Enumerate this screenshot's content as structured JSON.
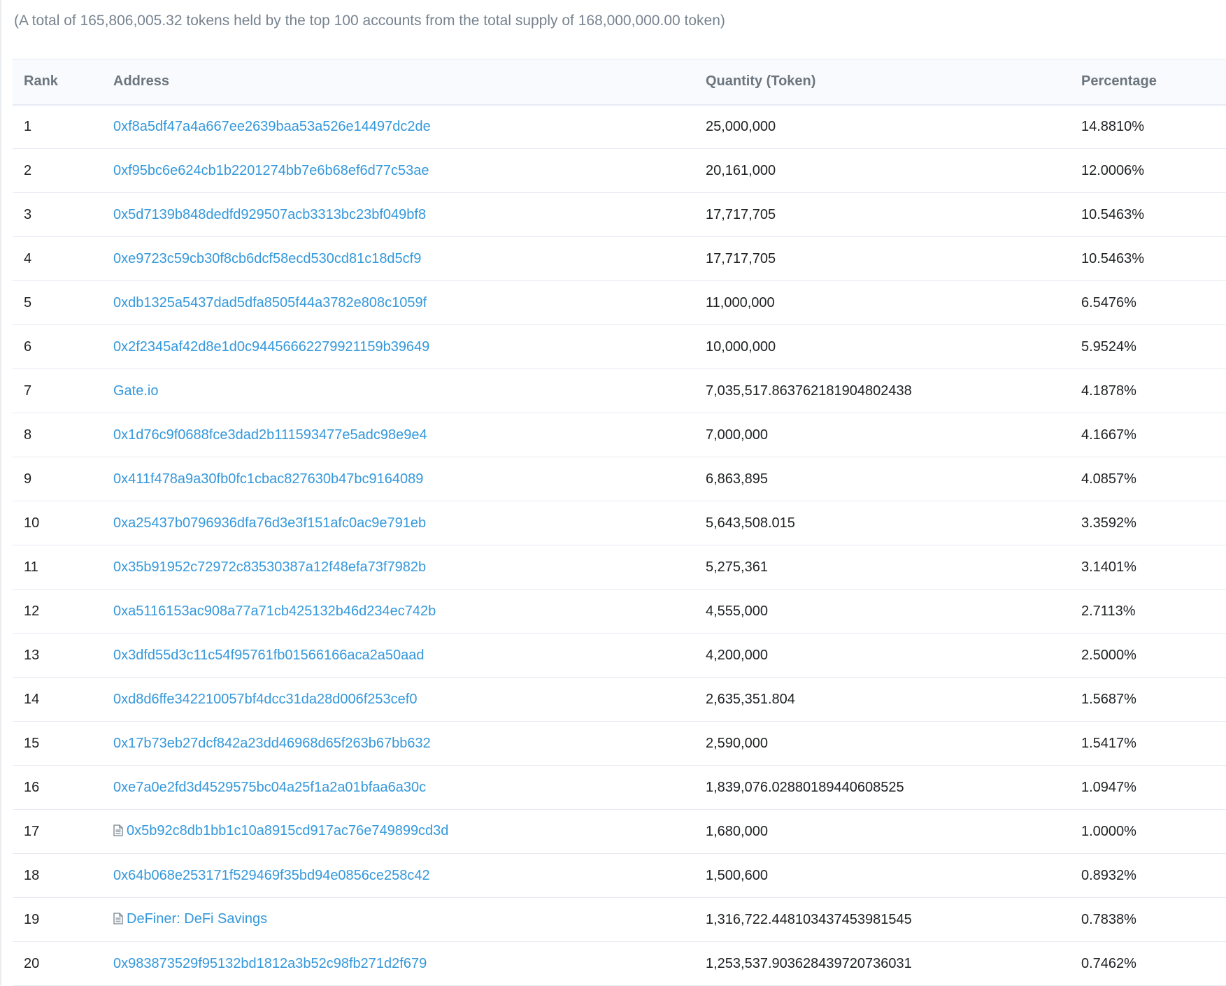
{
  "summary": "(A total of 165,806,005.32 tokens held by the top 100 accounts from the total supply of 168,000,000.00 token)",
  "headers": {
    "rank": "Rank",
    "address": "Address",
    "quantity": "Quantity (Token)",
    "percentage": "Percentage"
  },
  "colors": {
    "link": "#3498db",
    "header_text": "#6c757e",
    "summary_text": "#77838f"
  },
  "rows": [
    {
      "rank": "1",
      "address": "0xf8a5df47a4a667ee2639baa53a526e14497dc2de",
      "quantity": "25,000,000",
      "percentage": "14.8810%",
      "icon": ""
    },
    {
      "rank": "2",
      "address": "0xf95bc6e624cb1b2201274bb7e6b68ef6d77c53ae",
      "quantity": "20,161,000",
      "percentage": "12.0006%",
      "icon": ""
    },
    {
      "rank": "3",
      "address": "0x5d7139b848dedfd929507acb3313bc23bf049bf8",
      "quantity": "17,717,705",
      "percentage": "10.5463%",
      "icon": ""
    },
    {
      "rank": "4",
      "address": "0xe9723c59cb30f8cb6dcf58ecd530cd81c18d5cf9",
      "quantity": "17,717,705",
      "percentage": "10.5463%",
      "icon": ""
    },
    {
      "rank": "5",
      "address": "0xdb1325a5437dad5dfa8505f44a3782e808c1059f",
      "quantity": "11,000,000",
      "percentage": "6.5476%",
      "icon": ""
    },
    {
      "rank": "6",
      "address": "0x2f2345af42d8e1d0c94456662279921159b39649",
      "quantity": "10,000,000",
      "percentage": "5.9524%",
      "icon": ""
    },
    {
      "rank": "7",
      "address": "Gate.io",
      "quantity": "7,035,517.863762181904802438",
      "percentage": "4.1878%",
      "icon": ""
    },
    {
      "rank": "8",
      "address": "0x1d76c9f0688fce3dad2b111593477e5adc98e9e4",
      "quantity": "7,000,000",
      "percentage": "4.1667%",
      "icon": ""
    },
    {
      "rank": "9",
      "address": "0x411f478a9a30fb0fc1cbac827630b47bc9164089",
      "quantity": "6,863,895",
      "percentage": "4.0857%",
      "icon": ""
    },
    {
      "rank": "10",
      "address": "0xa25437b0796936dfa76d3e3f151afc0ac9e791eb",
      "quantity": "5,643,508.015",
      "percentage": "3.3592%",
      "icon": ""
    },
    {
      "rank": "11",
      "address": "0x35b91952c72972c83530387a12f48efa73f7982b",
      "quantity": "5,275,361",
      "percentage": "3.1401%",
      "icon": ""
    },
    {
      "rank": "12",
      "address": "0xa5116153ac908a77a71cb425132b46d234ec742b",
      "quantity": "4,555,000",
      "percentage": "2.7113%",
      "icon": ""
    },
    {
      "rank": "13",
      "address": "0x3dfd55d3c11c54f95761fb01566166aca2a50aad",
      "quantity": "4,200,000",
      "percentage": "2.5000%",
      "icon": ""
    },
    {
      "rank": "14",
      "address": "0xd8d6ffe342210057bf4dcc31da28d006f253cef0",
      "quantity": "2,635,351.804",
      "percentage": "1.5687%",
      "icon": ""
    },
    {
      "rank": "15",
      "address": "0x17b73eb27dcf842a23dd46968d65f263b67bb632",
      "quantity": "2,590,000",
      "percentage": "1.5417%",
      "icon": ""
    },
    {
      "rank": "16",
      "address": "0xe7a0e2fd3d4529575bc04a25f1a2a01bfaa6a30c",
      "quantity": "1,839,076.02880189440608525",
      "percentage": "1.0947%",
      "icon": ""
    },
    {
      "rank": "17",
      "address": "0x5b92c8db1bb1c10a8915cd917ac76e749899cd3d",
      "quantity": "1,680,000",
      "percentage": "1.0000%",
      "icon": "contract-document-icon"
    },
    {
      "rank": "18",
      "address": "0x64b068e253171f529469f35bd94e0856ce258c42",
      "quantity": "1,500,600",
      "percentage": "0.8932%",
      "icon": ""
    },
    {
      "rank": "19",
      "address": "DeFiner: DeFi Savings",
      "quantity": "1,316,722.448103437453981545",
      "percentage": "0.7838%",
      "icon": "contract-document-icon"
    },
    {
      "rank": "20",
      "address": "0x983873529f95132bd1812a3b52c98fb271d2f679",
      "quantity": "1,253,537.903628439720736031",
      "percentage": "0.7462%",
      "icon": ""
    }
  ]
}
